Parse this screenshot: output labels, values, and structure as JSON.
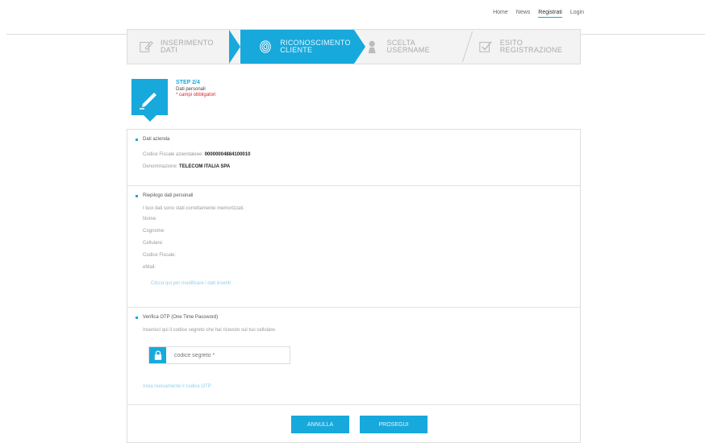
{
  "topnav": {
    "items": [
      "Home",
      "News",
      "Registrati",
      "Login"
    ],
    "active_index": 2
  },
  "steps": [
    {
      "line1": "INSERIMENTO",
      "line2": "DATI",
      "icon": "edit-form-icon",
      "state": "done"
    },
    {
      "line1": "RICONOSCIMENTO",
      "line2": "CLIENTE",
      "icon": "fingerprint-icon",
      "state": "active"
    },
    {
      "line1": "SCELTA",
      "line2": "USERNAME",
      "icon": "user-key-icon",
      "state": "todo"
    },
    {
      "line1": "ESITO",
      "line2": "REGISTRAZIONE",
      "icon": "check-box-icon",
      "state": "todo"
    }
  ],
  "step_info": {
    "title": "STEP 2/4",
    "subtitle": "Dati personali",
    "required_note": "* campi obbligatori"
  },
  "company": {
    "title": "Dati azienda",
    "fiscal_code_label": "Codice Fiscale aziendaleee:",
    "fiscal_code_value": "00000004884100010",
    "name_label": "Denominazione:",
    "name_value": "TELECOM ITALIA SPA"
  },
  "personal": {
    "title": "Riepilogo dati personali",
    "intro": "I tuoi dati sono stati correttamente memorizzati.",
    "fields": [
      "Nome:",
      "Cognome:",
      "Cellulare:",
      "Codice Fiscale:",
      "eMail:"
    ],
    "edit_link": "Clicca qui per modificare i dati inseriti"
  },
  "otp": {
    "title": "Verifica OTP (One Time Password)",
    "intro": "Inserisci qui il codice segreto che hai ricevuto sul tuo cellulare.",
    "placeholder": "codice segreto *",
    "resend_link": "Invia nuovamente il codice OTP"
  },
  "buttons": {
    "cancel": "ANNULLA",
    "proceed": "PROSEGUI"
  },
  "colors": {
    "accent": "#17a9dc",
    "required": "#dd2233"
  }
}
